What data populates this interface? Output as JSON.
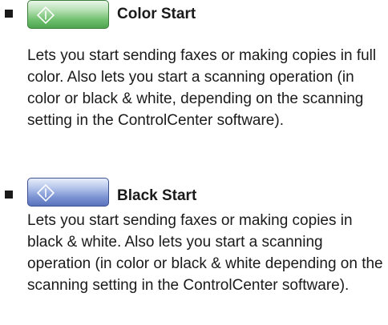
{
  "entries": [
    {
      "icon": "start-diamond-icon",
      "key_color": "#6fbf6e",
      "title": "Color Start",
      "description": "Lets you start sending faxes or making copies in full color. Also lets you start a scanning operation (in color or black & white, depending on the scanning setting in the ControlCenter software)."
    },
    {
      "icon": "start-diamond-icon",
      "key_color": "#7a92d2",
      "title": "Black Start",
      "description": "Lets you start sending faxes or making copies in black & white. Also lets you start a scanning operation (in color or black & white depending on the scanning setting in the ControlCenter software)."
    }
  ]
}
